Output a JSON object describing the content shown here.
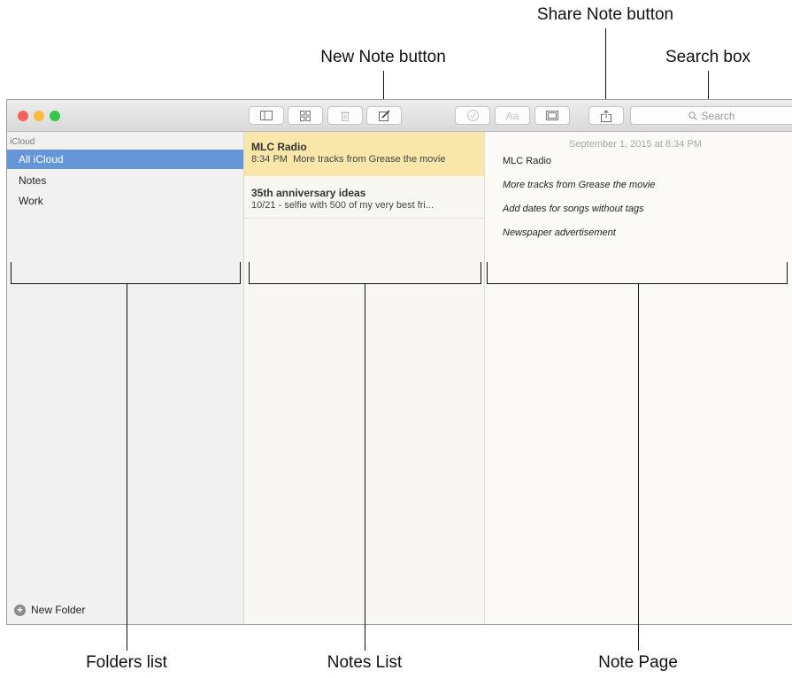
{
  "callouts": {
    "share_note": "Share Note button",
    "new_note": "New Note button",
    "search_box": "Search box",
    "folders_list": "Folders list",
    "notes_list": "Notes List",
    "note_page": "Note Page"
  },
  "toolbar": {
    "search_placeholder": "Search",
    "format_label": "Aa"
  },
  "sidebar": {
    "group": "iCloud",
    "folders": [
      "All iCloud",
      "Notes",
      "Work"
    ],
    "selected_index": 0,
    "new_folder": "New Folder"
  },
  "notes": [
    {
      "title": "MLC Radio",
      "time": "8:34 PM",
      "snippet": "More tracks from Grease the movie"
    },
    {
      "title": "35th anniversary ideas",
      "time": "10/21",
      "snippet": "- selfie with 500 of my very best fri..."
    }
  ],
  "note_page": {
    "date": "September 1, 2015 at 8:34 PM",
    "title": "MLC Radio",
    "lines": [
      "More tracks from Grease the movie",
      "Add dates for songs without tags",
      "Newspaper advertisement"
    ]
  },
  "colors": {
    "selection_blue": "#6496d8",
    "selected_note": "#f8e7a8",
    "close": "#fc605c",
    "minimize": "#fdbc40",
    "zoom": "#34c84a"
  }
}
